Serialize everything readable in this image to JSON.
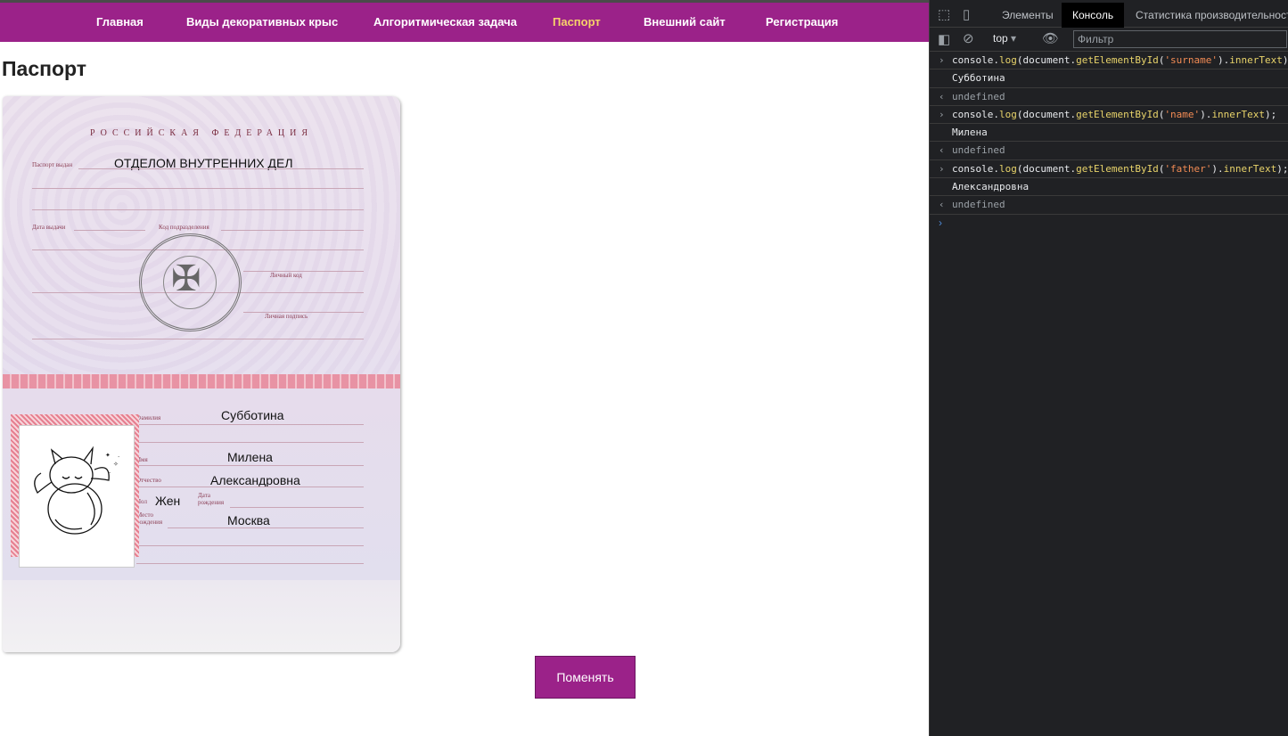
{
  "nav": {
    "items": [
      {
        "label": "Главная"
      },
      {
        "label": "Виды декоративных крыс"
      },
      {
        "label": "Алгоритмическая задача"
      },
      {
        "label": "Паспорт"
      },
      {
        "label": "Внешний сайт"
      },
      {
        "label": "Регистрация"
      }
    ],
    "active_color": "#f7d26a",
    "bar_color": "#9b2289"
  },
  "page": {
    "title": "Паспорт",
    "change_button": "Поменять"
  },
  "passport": {
    "heading": "РОССИЙСКАЯ ФЕДЕРАЦИЯ",
    "issued_by_label": "Паспорт выдан",
    "issued_by": "ОТДЕЛОМ ВНУТРЕННИХ ДЕЛ",
    "issue_date_label": "Дата выдачи",
    "division_code_label": "Код подразделения",
    "personal_code_label": "Личный код",
    "signature_label": "Личная подпись",
    "surname_label": "Фамилия",
    "surname": "Субботина",
    "name_label": "Имя",
    "name": "Милена",
    "patronymic_label": "Отчество",
    "patronymic": "Александровна",
    "sex_label": "Пол",
    "sex": "Жен",
    "birth_date_label": "Дата рождения",
    "birth_place_label": "Место рождения",
    "birth_place": "Москва"
  },
  "devtools": {
    "tabs": [
      {
        "label": "Элементы"
      },
      {
        "label": "Консоль"
      },
      {
        "label": "Статистика производительности"
      }
    ],
    "context": "top",
    "filter_placeholder": "Фильтр",
    "console": {
      "cmd1": {
        "obj": "console.",
        "fn": "log",
        "mid": "(document.",
        "fn2": "getElementById",
        "open": "(",
        "arg": "'surname'",
        "close": ").",
        "prop": "innerText",
        "end": ")"
      },
      "out1": "Субботина",
      "res1": "undefined",
      "cmd2": {
        "obj": "console.",
        "fn": "log",
        "mid": "(document.",
        "fn2": "getElementById",
        "open": "(",
        "arg": "'name'",
        "close": ").",
        "prop": "innerText",
        "end": ");"
      },
      "out2": "Милена",
      "res2": "undefined",
      "cmd3": {
        "obj": "console.",
        "fn": "log",
        "mid": "(document.",
        "fn2": "getElementById",
        "open": "(",
        "arg": "'father'",
        "close": ").",
        "prop": "innerText",
        "end": ");"
      },
      "out3": "Александровна",
      "res3": "undefined"
    }
  }
}
